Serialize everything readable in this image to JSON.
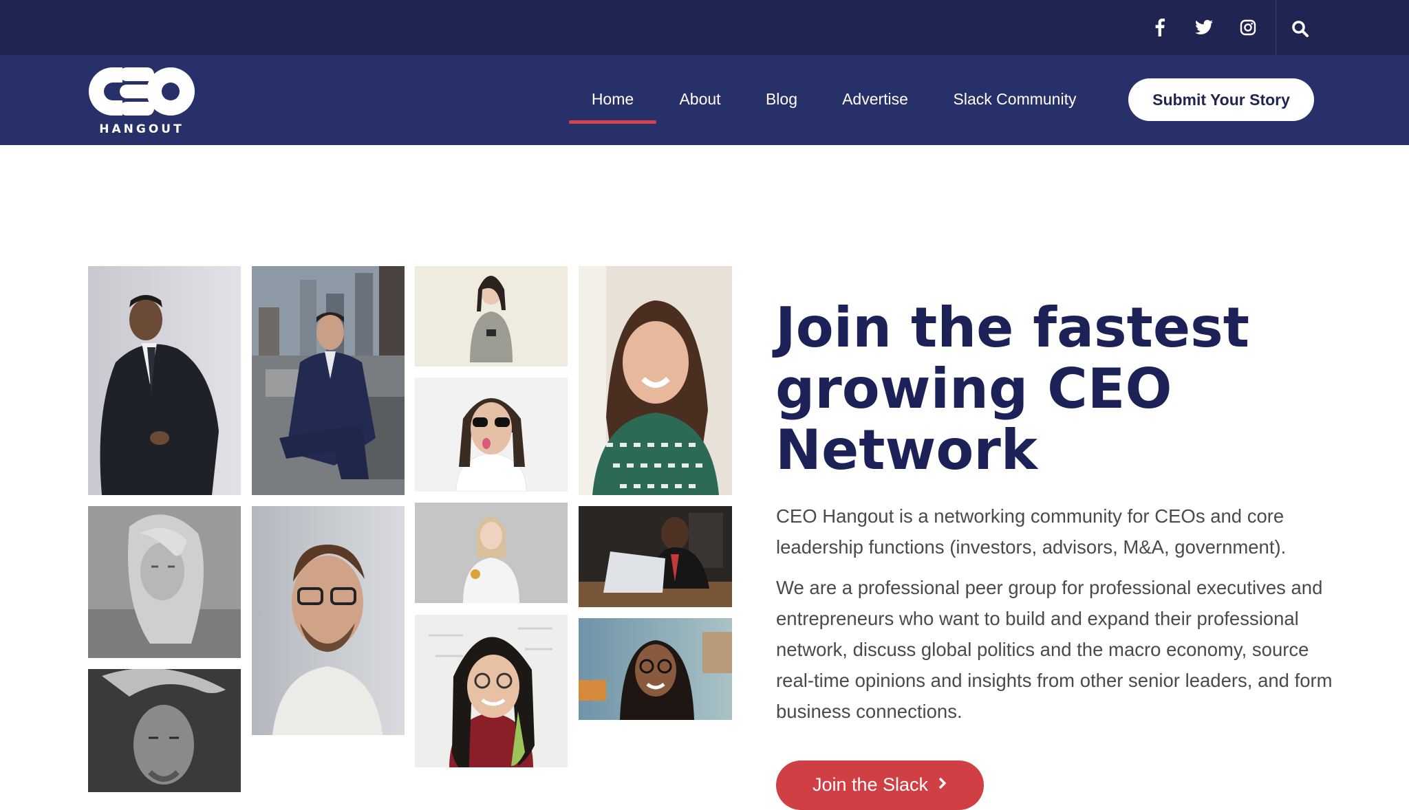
{
  "topbar": {
    "social": [
      {
        "icon": "facebook-icon"
      },
      {
        "icon": "twitter-icon"
      },
      {
        "icon": "instagram-icon"
      }
    ],
    "search_icon": "search-icon"
  },
  "brand": {
    "logo_mark": "CEO",
    "logo_sub": "HANGOUT"
  },
  "nav": {
    "items": [
      {
        "label": "Home",
        "active": true
      },
      {
        "label": "About"
      },
      {
        "label": "Blog"
      },
      {
        "label": "Advertise"
      },
      {
        "label": "Slack Community"
      }
    ],
    "cta": "Submit Your Story"
  },
  "hero": {
    "title": "Join the fastest growing CEO Network",
    "para1": "CEO Hangout is a networking community for CEOs and core leadership functions (investors, advisors, M&A, government).",
    "para2": "We are a professional peer group for professional executives and entrepreneurs who want to build and expand their professional network, discuss global politics and the macro economy, source real-time opinions and insights from other senior leaders, and form business connections.",
    "cta": "Join the Slack"
  },
  "colors": {
    "topbar": "#1f2550",
    "navbar": "#28306a",
    "accent_red": "#cf3f44",
    "title_navy": "#1c2257",
    "body_text": "#4a4a4a"
  }
}
